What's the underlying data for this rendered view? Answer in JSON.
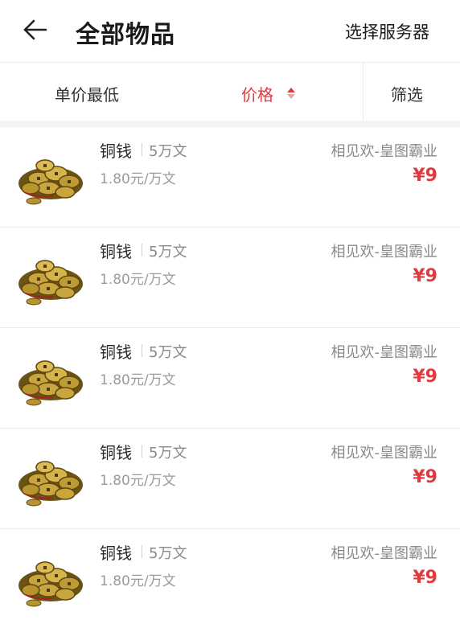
{
  "header": {
    "title": "全部物品",
    "server_button": "选择服务器",
    "back_icon": "arrow-left-icon"
  },
  "filter": {
    "sort_lowest_unit": "单价最低",
    "sort_price": "价格",
    "sort_price_icon": "sort-arrows-icon",
    "filter": "筛选",
    "active_color": "#e0393e"
  },
  "items": [
    {
      "name": "铜钱",
      "quantity": "5万文",
      "unit_price": "1.80元/万文",
      "server": "相见欢-皇图霸业",
      "price": "¥9",
      "image_icon": "copper-coins-icon"
    },
    {
      "name": "铜钱",
      "quantity": "5万文",
      "unit_price": "1.80元/万文",
      "server": "相见欢-皇图霸业",
      "price": "¥9",
      "image_icon": "copper-coins-icon"
    },
    {
      "name": "铜钱",
      "quantity": "5万文",
      "unit_price": "1.80元/万文",
      "server": "相见欢-皇图霸业",
      "price": "¥9",
      "image_icon": "copper-coins-icon"
    },
    {
      "name": "铜钱",
      "quantity": "5万文",
      "unit_price": "1.80元/万文",
      "server": "相见欢-皇图霸业",
      "price": "¥9",
      "image_icon": "copper-coins-icon"
    },
    {
      "name": "铜钱",
      "quantity": "5万文",
      "unit_price": "1.80元/万文",
      "server": "相见欢-皇图霸业",
      "price": "¥9",
      "image_icon": "copper-coins-icon"
    }
  ]
}
